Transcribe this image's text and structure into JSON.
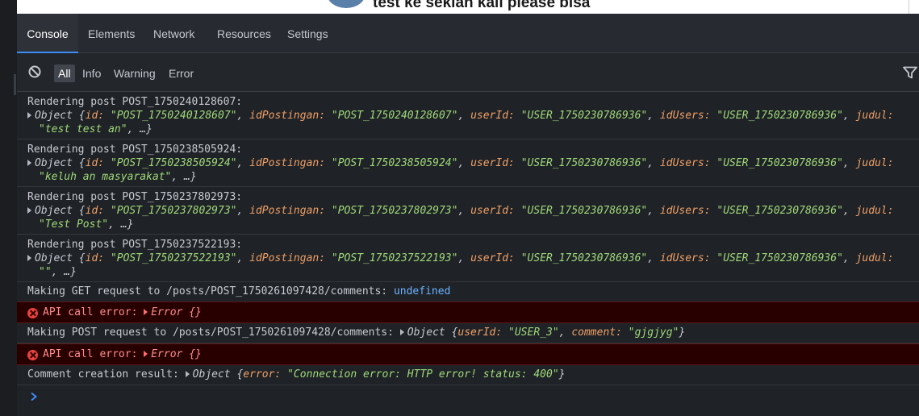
{
  "page": {
    "post_title": "test ke sekian kali please bisa"
  },
  "devtools": {
    "tabs": [
      {
        "label": "Console",
        "active": true
      },
      {
        "label": "Elements"
      },
      {
        "label": "Network"
      },
      {
        "label": "Resources"
      },
      {
        "label": "Settings"
      }
    ],
    "filters": [
      {
        "label": "All",
        "active": true
      },
      {
        "label": "Info"
      },
      {
        "label": "Warning"
      },
      {
        "label": "Error"
      }
    ],
    "icons": {
      "clear": "clear-console-icon",
      "filter": "funnel-icon",
      "expand": "disclosure-triangle-icon",
      "error": "error-circle-icon",
      "prompt": "chevron-right-icon"
    },
    "colors": {
      "accent": "#3d8bf5",
      "error_bg": "#290000",
      "error_text": "#ff8c8c",
      "string": "#9fd97a",
      "key": "#f0a068"
    }
  },
  "console": {
    "posts": [
      {
        "header": "Rendering post POST_1750240128607:",
        "id": "\"POST_1750240128607\"",
        "idPostingan": "\"POST_1750240128607\"",
        "userId": "\"USER_1750230786936\"",
        "idUsers": "\"USER_1750230786936\"",
        "judul": "\"test test an\""
      },
      {
        "header": "Rendering post POST_1750238505924:",
        "id": "\"POST_1750238505924\"",
        "idPostingan": "\"POST_1750238505924\"",
        "userId": "\"USER_1750230786936\"",
        "idUsers": "\"USER_1750230786936\"",
        "judul": "\"keluh an masyarakat\""
      },
      {
        "header": "Rendering post POST_1750237802973:",
        "id": "\"POST_1750237802973\"",
        "idPostingan": "\"POST_1750237802973\"",
        "userId": "\"USER_1750230786936\"",
        "idUsers": "\"USER_1750230786936\"",
        "judul": "\"Test Post\""
      },
      {
        "header": "Rendering post POST_1750237522193:",
        "id": "\"POST_1750237522193\"",
        "idPostingan": "\"POST_1750237522193\"",
        "userId": "\"USER_1750230786936\"",
        "idUsers": "\"USER_1750230786936\"",
        "judul": "\"\""
      }
    ],
    "labels": {
      "object": "Object {",
      "key_id": "id:",
      "key_idPostingan": "idPostingan:",
      "key_userId": "userId:",
      "key_idUsers": "idUsers:",
      "key_judul": "judul:",
      "key_comment": "comment:",
      "key_error": "error:",
      "more": ", …}",
      "close": "}",
      "comma": ","
    },
    "get_request": {
      "text": "Making GET request to /posts/POST_1750261097428/comments:",
      "value": "undefined"
    },
    "error1": {
      "text": "API call error:",
      "object": "Error {}"
    },
    "post_request": {
      "text": "Making POST request to /posts/POST_1750261097428/comments:",
      "userId": "\"USER_3\"",
      "comment": "\"gjgjyg\""
    },
    "error2": {
      "text": "API call error:",
      "object": "Error {}"
    },
    "result": {
      "text": "Comment creation result:",
      "error": "\"Connection error: HTTP error! status: 400\""
    }
  }
}
